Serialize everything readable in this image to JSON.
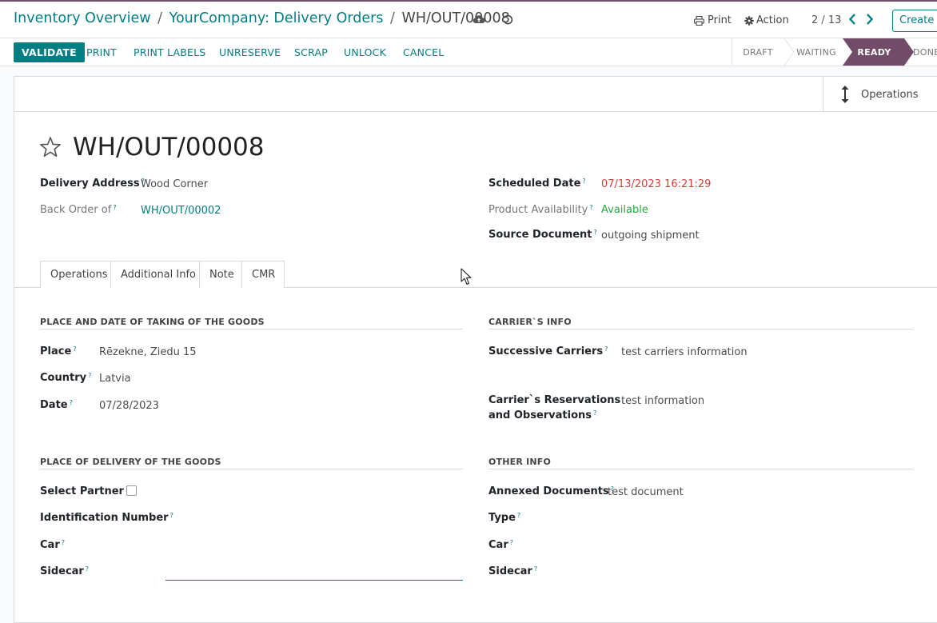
{
  "breadcrumb": {
    "items": [
      "Inventory Overview",
      "YourCompany: Delivery Orders"
    ],
    "current": "WH/OUT/00008",
    "separator": "/"
  },
  "toolbar": {
    "print_label": "Print",
    "action_label": "Action",
    "pager": "2 / 13",
    "create_label": "Create"
  },
  "statusbar": {
    "buttons": [
      "VALIDATE",
      "PRINT",
      "PRINT LABELS",
      "UNRESERVE",
      "SCRAP",
      "UNLOCK",
      "CANCEL"
    ],
    "stages": [
      "DRAFT",
      "WAITING",
      "READY",
      "DONE"
    ],
    "active_stage": "READY"
  },
  "smart_button": {
    "label": "Operations"
  },
  "record": {
    "title": "WH/OUT/00008",
    "delivery_address_label": "Delivery Address",
    "delivery_address": "Wood Corner",
    "back_order_label": "Back Order of",
    "back_order": "WH/OUT/00002",
    "scheduled_date_label": "Scheduled Date",
    "scheduled_date": "07/13/2023 16:21:29",
    "availability_label": "Product Availability",
    "availability": "Available",
    "source_document_label": "Source Document",
    "source_document": "outgoing shipment"
  },
  "tabs": [
    "Operations",
    "Additional Info",
    "Note",
    "CMR"
  ],
  "active_tab": "CMR",
  "cmr": {
    "taking": {
      "title": "PLACE AND DATE OF TAKING OF THE GOODS",
      "place_label": "Place",
      "place": "Rēzekne, Ziedu 15",
      "country_label": "Country",
      "country": "Latvia",
      "date_label": "Date",
      "date": "07/28/2023"
    },
    "carrier": {
      "title": "CARRIER`S INFO",
      "successive_label": "Successive Carriers",
      "successive": "test carriers information",
      "reservations_label_1": "Carrier`s Reservations",
      "reservations_label_2": "and Observations",
      "reservations": "test information"
    },
    "delivery": {
      "title": "PLACE OF DELIVERY OF THE GOODS",
      "select_partner_label": "Select Partner",
      "identification_label": "Identification Number",
      "car_label": "Car",
      "sidecar_label": "Sidecar"
    },
    "other": {
      "title": "OTHER INFO",
      "annexed_label": "Annexed Documents",
      "annexed": "test document",
      "type_label": "Type",
      "car_label": "Car",
      "sidecar_label": "Sidecar"
    }
  },
  "help_mark": "?",
  "colors": {
    "brand": "#714b67",
    "accent": "#017e84",
    "danger": "#d23f3a",
    "success": "#28a745"
  },
  "icons": [
    "cloud-upload-icon",
    "discard-icon",
    "printer-icon",
    "gear-icon",
    "chevron-left-icon",
    "chevron-right-icon",
    "vertical-arrows-icon",
    "star-icon",
    "mouse-cursor-icon"
  ]
}
